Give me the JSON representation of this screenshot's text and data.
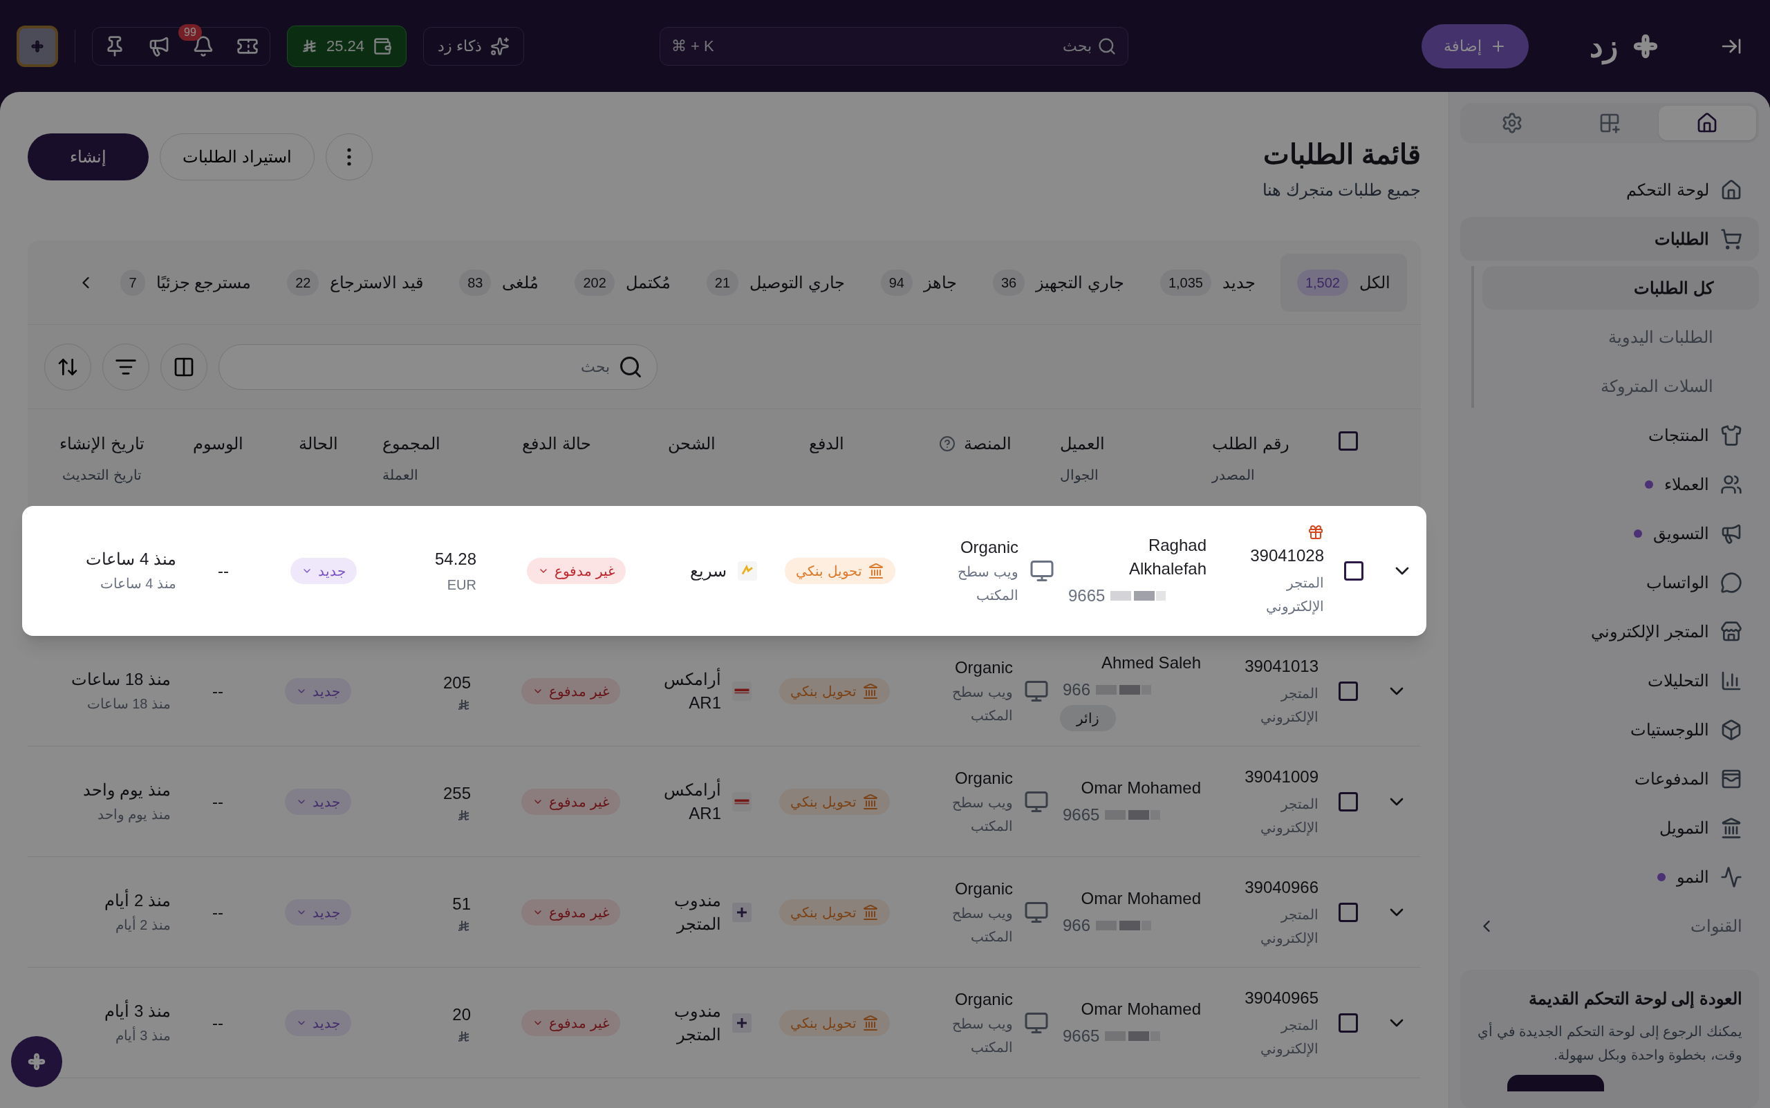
{
  "top_bar": {
    "logo": "زد",
    "add_button": "إضافة",
    "search": {
      "placeholder": "بحث",
      "shortcut": "⌘ + K"
    },
    "ai_button": "ذكاء زد",
    "balance": "25.24",
    "notifications_badge": "99"
  },
  "sidebar": {
    "tabs": [
      {
        "kind": "home",
        "selected": true
      },
      {
        "kind": "apps",
        "selected": false
      },
      {
        "kind": "settings",
        "selected": false
      }
    ],
    "items": [
      {
        "label": "لوحة التحكم",
        "selected": false,
        "dot": false
      },
      {
        "label": "الطلبات",
        "selected": true,
        "dot": false,
        "children": [
          {
            "label": "كل الطلبات",
            "selected": true
          },
          {
            "label": "الطلبات اليدوية",
            "selected": false
          },
          {
            "label": "السلات المتروكة",
            "selected": false
          }
        ]
      },
      {
        "label": "المنتجات",
        "selected": false,
        "dot": false
      },
      {
        "label": "العملاء",
        "selected": false,
        "dot": true
      },
      {
        "label": "التسويق",
        "selected": false,
        "dot": true
      },
      {
        "label": "الواتساب",
        "selected": false,
        "dot": false
      },
      {
        "label": "المتجر الإلكتروني",
        "selected": false,
        "dot": false
      },
      {
        "label": "التحليلات",
        "selected": false,
        "dot": false
      },
      {
        "label": "اللوجستيات",
        "selected": false,
        "dot": false
      },
      {
        "label": "المدفوعات",
        "selected": false,
        "dot": false
      },
      {
        "label": "التمويل",
        "selected": false,
        "dot": false
      },
      {
        "label": "النمو",
        "selected": false,
        "dot": true
      }
    ],
    "channels": "القنوات",
    "promo": {
      "title": "العودة إلى لوحة التحكم القديمة",
      "text": "يمكنك الرجوع إلى لوحة التحكم الجديدة في أي وقت، بخطوة واحدة وبكل سهولة."
    }
  },
  "page": {
    "title": "قائمة الطلبات",
    "subtitle": "جميع طلبات متجرك هنا",
    "create_button": "إنشاء",
    "import_button": "استيراد الطلبات"
  },
  "status_tabs": [
    {
      "label": "الكل",
      "count": "1,502",
      "selected": true
    },
    {
      "label": "جديد",
      "count": "1,035",
      "selected": false
    },
    {
      "label": "جاري التجهيز",
      "count": "36",
      "selected": false
    },
    {
      "label": "جاهز",
      "count": "94",
      "selected": false
    },
    {
      "label": "جاري التوصيل",
      "count": "21",
      "selected": false
    },
    {
      "label": "مُكتمل",
      "count": "202",
      "selected": false
    },
    {
      "label": "مُلغى",
      "count": "83",
      "selected": false
    },
    {
      "label": "قيد الاسترجاع",
      "count": "22",
      "selected": false
    },
    {
      "label": "مسترجع جزئيًا",
      "count": "7",
      "selected": false
    }
  ],
  "search": {
    "placeholder": "بحث"
  },
  "table": {
    "select_all": {
      "checked": false
    },
    "columns": [
      {
        "title": "رقم الطلب",
        "subtitle": "المصدر"
      },
      {
        "title": "العميل",
        "subtitle": "الجوال"
      },
      {
        "title": "المنصة",
        "help": true
      },
      {
        "title": "الدفع"
      },
      {
        "title": "الشحن"
      },
      {
        "title": "حالة الدفع"
      },
      {
        "title": "المجموع",
        "subtitle": "العملة"
      },
      {
        "title": "الحالة"
      },
      {
        "title": "الوسوم"
      },
      {
        "title": "تاريخ الإنشاء",
        "subtitle": "تاريخ التحديث"
      }
    ],
    "rows": [
      {
        "highlighted": true,
        "checked": false,
        "gift": true,
        "order": "39041028",
        "source": "المتجر الإلكتروني",
        "customer": "Raghad Alkhalefah",
        "phone": "9665",
        "platform": "Organic",
        "device": "ويب سطح المكتب",
        "payment": "تحويل بنكي",
        "shipping": {
          "kind": "fast",
          "label": "سريع"
        },
        "payment_status": "غير مدفوع",
        "total": "54.28",
        "currency": {
          "kind": "text",
          "text": "EUR"
        },
        "status": "جديد",
        "tags": "--",
        "created": "منذ 4 ساعات",
        "updated": "منذ 4 ساعات"
      },
      {
        "highlighted": false,
        "checked": false,
        "gift": false,
        "order": "39041013",
        "source": "المتجر الإلكتروني",
        "customer": "Ahmed Saleh",
        "phone": "966",
        "badge": "زائر",
        "platform": "Organic",
        "device": "ويب سطح المكتب",
        "payment": "تحويل بنكي",
        "shipping": {
          "kind": "aramex",
          "label": "أرامكس AR1"
        },
        "payment_status": "غير مدفوع",
        "total": "205",
        "currency": {
          "kind": "riyal"
        },
        "status": "جديد",
        "tags": "--",
        "created": "منذ 18 ساعات",
        "updated": "منذ 18 ساعات"
      },
      {
        "highlighted": false,
        "checked": false,
        "gift": false,
        "order": "39041009",
        "source": "المتجر الإلكتروني",
        "customer": "Omar Mohamed",
        "phone": "9665",
        "platform": "Organic",
        "device": "ويب سطح المكتب",
        "payment": "تحويل بنكي",
        "shipping": {
          "kind": "aramex",
          "label": "أرامكس AR1"
        },
        "payment_status": "غير مدفوع",
        "total": "255",
        "currency": {
          "kind": "riyal"
        },
        "status": "جديد",
        "tags": "--",
        "created": "منذ يوم واحد",
        "updated": "منذ يوم واحد"
      },
      {
        "highlighted": false,
        "checked": false,
        "gift": false,
        "order": "39040966",
        "source": "المتجر الإلكتروني",
        "customer": "Omar Mohamed",
        "phone": "966",
        "platform": "Organic",
        "device": "ويب سطح المكتب",
        "payment": "تحويل بنكي",
        "shipping": {
          "kind": "store",
          "label": "مندوب المتجر"
        },
        "payment_status": "غير مدفوع",
        "total": "51",
        "currency": {
          "kind": "riyal"
        },
        "status": "جديد",
        "tags": "--",
        "created": "منذ 2 أيام",
        "updated": "منذ 2 أيام"
      },
      {
        "highlighted": false,
        "checked": false,
        "gift": false,
        "order": "39040965",
        "source": "المتجر الإلكتروني",
        "customer": "Omar Mohamed",
        "phone": "9665",
        "platform": "Organic",
        "device": "ويب سطح المكتب",
        "payment": "تحويل بنكي",
        "shipping": {
          "kind": "store",
          "label": "مندوب المتجر"
        },
        "payment_status": "غير مدفوع",
        "total": "20",
        "currency": {
          "kind": "riyal"
        },
        "status": "جديد",
        "tags": "--",
        "created": "منذ 3 أيام",
        "updated": "منذ 3 أيام"
      }
    ]
  }
}
